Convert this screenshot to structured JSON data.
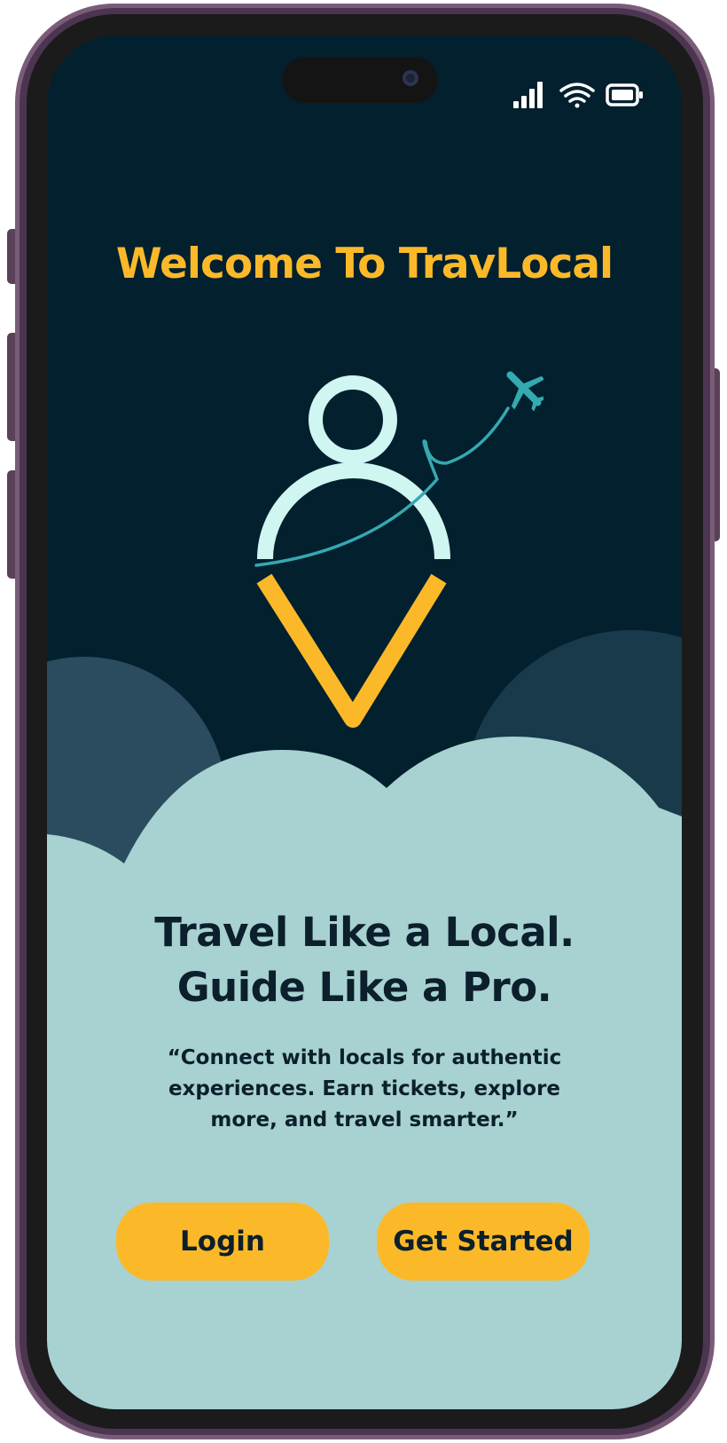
{
  "status_bar": {
    "icons": [
      "signal-icon",
      "wifi-icon",
      "battery-icon"
    ]
  },
  "welcome": {
    "title": "Welcome To TravLocal"
  },
  "logo": {
    "icon": "location-person-pin-with-airplane",
    "colors": {
      "person": "#cff6f1",
      "pin": "#fbb929",
      "flight_path": "#35a9b0"
    }
  },
  "hero": {
    "line1": "Travel Like a Local.",
    "line2": "Guide Like a Pro.",
    "quote": "“Connect with locals for authentic experiences. Earn tickets, explore more, and travel smarter.”"
  },
  "actions": {
    "login_label": "Login",
    "get_started_label": "Get Started"
  },
  "colors": {
    "background": "#03202f",
    "cloud": "#a7d2d1",
    "accent": "#fbb929",
    "text_dark": "#0c1f2c"
  }
}
